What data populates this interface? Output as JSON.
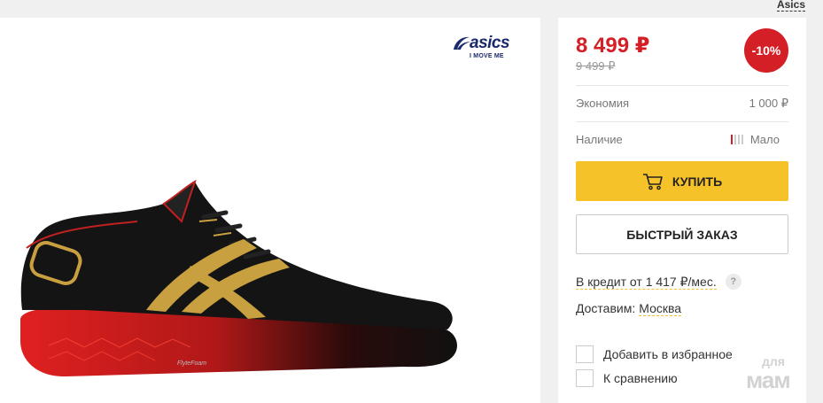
{
  "brand_link": "Asics",
  "product": {
    "brand_logo": {
      "name": "asics",
      "tagline": "I MOVE ME"
    },
    "shoe_text": "FlyteFoam"
  },
  "pricing": {
    "current": "8 499 ₽",
    "old": "9 499 ₽",
    "discount": "-10%",
    "savings_label": "Экономия",
    "savings_value": "1 000 ₽",
    "stock_label": "Наличие",
    "stock_value": "Мало",
    "stock_level": 0.25
  },
  "actions": {
    "buy_label": "КУПИТЬ",
    "quick_order_label": "БЫСТРЫЙ ЗАКАЗ"
  },
  "credit": {
    "text": "В кредит от 1 417 ₽/мес.",
    "help": "?"
  },
  "delivery": {
    "label": "Доставим:",
    "city": "Москва"
  },
  "options": {
    "favorites": "Добавить в избранное",
    "compare": "К сравнению"
  },
  "watermark": {
    "small": "для",
    "big": "мам"
  },
  "colors": {
    "accent_red": "#d41f26",
    "button_yellow": "#f6c22a",
    "brand_navy": "#1a2a6c"
  },
  "icons": {
    "cart": "cart-icon",
    "help": "help-icon",
    "stock": "stock-level-icon"
  }
}
